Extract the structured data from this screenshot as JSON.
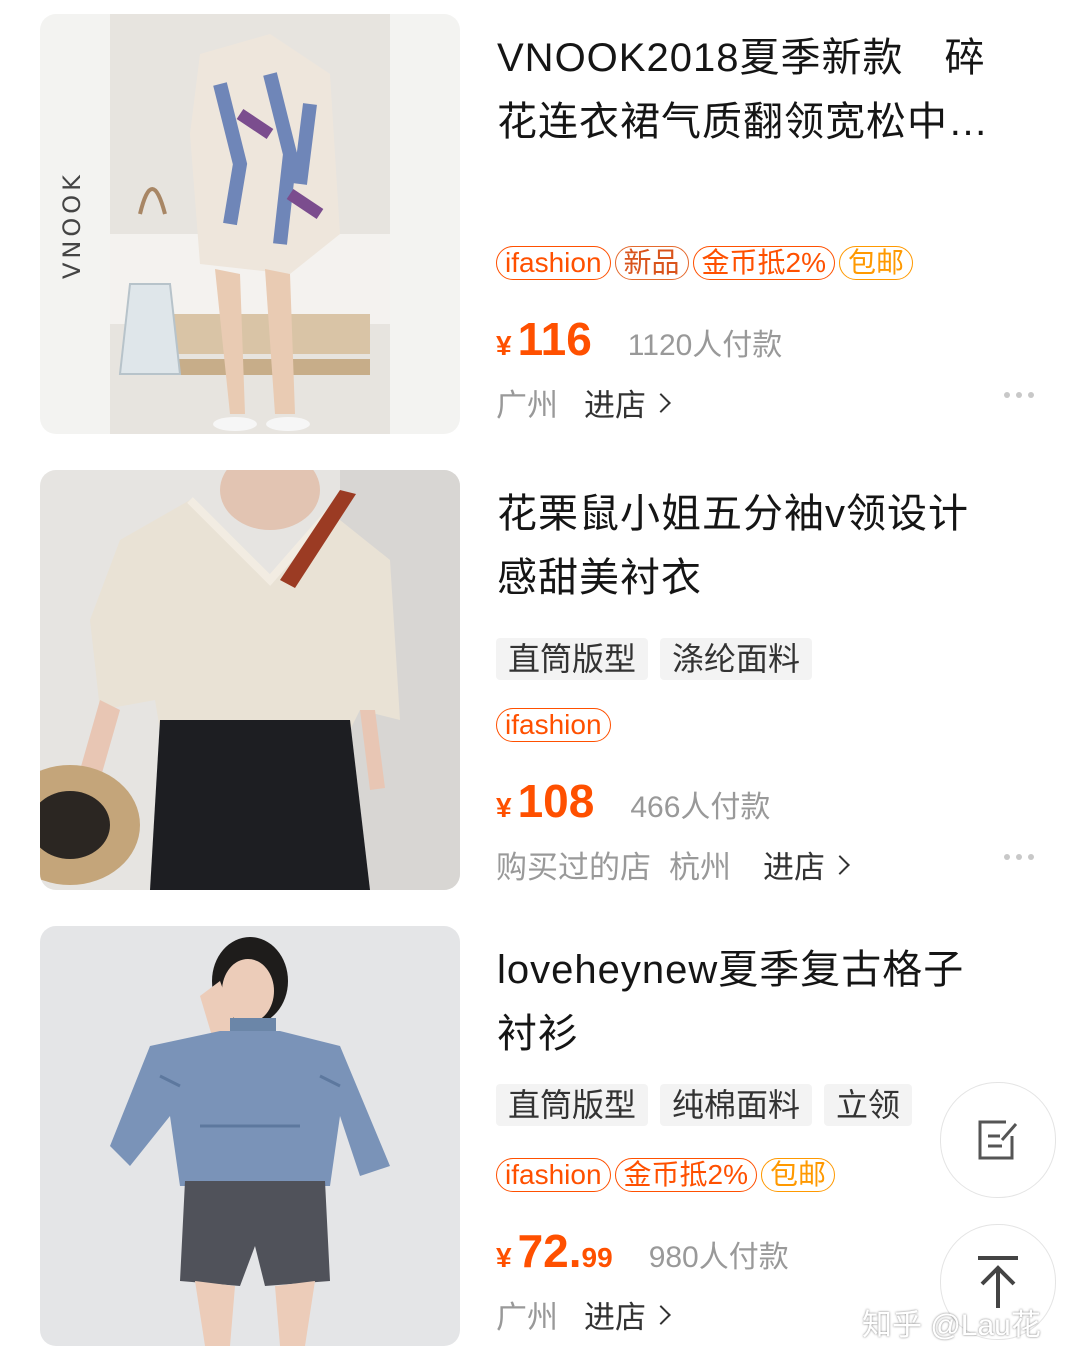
{
  "products": [
    {
      "title_line1": "VNOOK2018夏季新款　碎",
      "title_line2": "花连衣裙气质翻领宽松中…",
      "badges": [
        "ifashion",
        "新品",
        "金币抵2%",
        "包邮"
      ],
      "brand_watermark": "VNOOK",
      "price_symbol": "¥",
      "price_int": "116",
      "price_dec": "",
      "sales": "1120人付款",
      "shop_note": "",
      "location": "广州",
      "enter_shop": "进店"
    },
    {
      "title_line1": "花栗鼠小姐五分袖v领设计",
      "title_line2": "感甜美衬衣",
      "attr_tags": [
        "直筒版型",
        "涤纶面料"
      ],
      "badges": [
        "ifashion"
      ],
      "price_symbol": "¥",
      "price_int": "108",
      "price_dec": "",
      "sales": "466人付款",
      "shop_note": "购买过的店",
      "location": "杭州",
      "enter_shop": "进店"
    },
    {
      "title_line1": "loveheynew夏季复古格子",
      "title_line2": "衬衫",
      "attr_tags": [
        "直筒版型",
        "纯棉面料",
        "立领"
      ],
      "badges": [
        "ifashion",
        "金币抵2%",
        "包邮"
      ],
      "price_symbol": "¥",
      "price_int": "72.",
      "price_dec": "99",
      "sales": "980人付款",
      "shop_note": "",
      "location": "广州",
      "enter_shop": "进店"
    }
  ],
  "floating": {
    "feedback_icon": "edit-note-icon",
    "top_icon": "back-to-top-icon"
  },
  "watermark": "知乎 @Lau花",
  "colors": {
    "price": "#ff5000",
    "badge_gold": "#ff9900",
    "muted": "#999999"
  }
}
